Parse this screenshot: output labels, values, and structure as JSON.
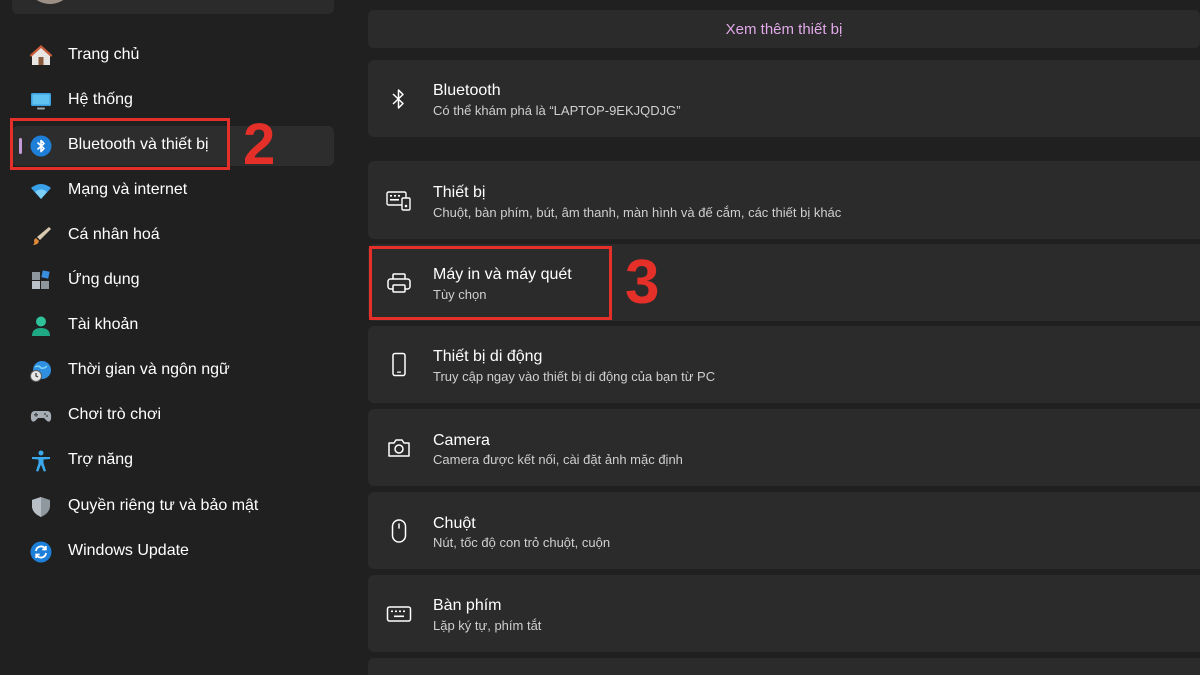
{
  "sidebar": {
    "items": [
      {
        "label": "Trang chủ",
        "icon": "home-icon"
      },
      {
        "label": "Hệ thống",
        "icon": "monitor-icon"
      },
      {
        "label": "Bluetooth và thiết bị",
        "icon": "bluetooth-icon",
        "active": true
      },
      {
        "label": "Mạng và internet",
        "icon": "wifi-icon"
      },
      {
        "label": "Cá nhân hoá",
        "icon": "brush-icon"
      },
      {
        "label": "Ứng dụng",
        "icon": "apps-icon"
      },
      {
        "label": "Tài khoản",
        "icon": "person-icon"
      },
      {
        "label": "Thời gian và ngôn ngữ",
        "icon": "globe-clock-icon"
      },
      {
        "label": "Chơi trò chơi",
        "icon": "gamepad-icon"
      },
      {
        "label": "Trợ năng",
        "icon": "accessibility-icon"
      },
      {
        "label": "Quyền riêng tư và bảo mật",
        "icon": "shield-icon"
      },
      {
        "label": "Windows Update",
        "icon": "update-icon"
      }
    ]
  },
  "annotations": {
    "step2": "2",
    "step3": "3"
  },
  "content": {
    "more_devices": "Xem thêm thiết bị",
    "cards": [
      {
        "title": "Bluetooth",
        "subtitle": "Có thể khám phá là “LAPTOP-9EKJQDJG”",
        "icon": "bluetooth-icon"
      },
      {
        "title": "Thiết bị",
        "subtitle": "Chuột, bàn phím, bút, âm thanh, màn hình và đế cắm, các thiết bị khác",
        "icon": "devices-icon"
      },
      {
        "title": "Máy in và máy quét",
        "subtitle": "Tùy chọn",
        "icon": "printer-icon"
      },
      {
        "title": "Thiết bị di động",
        "subtitle": "Truy cập ngay vào thiết bị di động của bạn từ PC",
        "icon": "phone-icon"
      },
      {
        "title": "Camera",
        "subtitle": "Camera được kết nối, cài đặt ảnh mặc định",
        "icon": "camera-icon"
      },
      {
        "title": "Chuột",
        "subtitle": "Nút, tốc độ con trỏ chuột, cuộn",
        "icon": "mouse-icon"
      },
      {
        "title": "Bàn phím",
        "subtitle": "Lặp ký tự, phím tắt",
        "icon": "keyboard-icon"
      }
    ]
  },
  "colors": {
    "background": "#202020",
    "card": "#2b2b2b",
    "accent": "#c59ad8",
    "annotation": "#e5302a"
  }
}
